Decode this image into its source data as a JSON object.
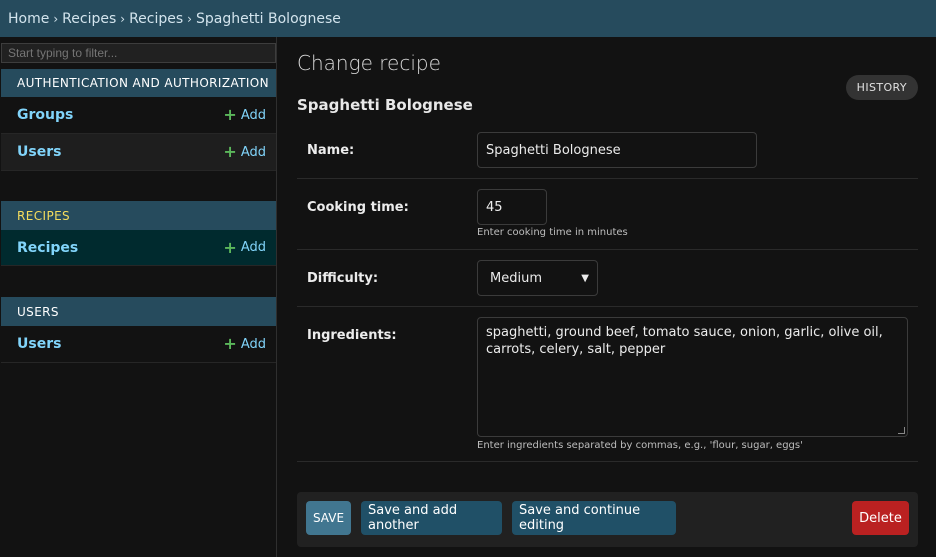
{
  "breadcrumbs": {
    "home": "Home",
    "app": "Recipes",
    "model": "Recipes",
    "current": "Spaghetti Bolognese",
    "separator": "›"
  },
  "sidebar": {
    "filter_placeholder": "Start typing to filter...",
    "add_label": "Add",
    "add_icon": "plus-icon",
    "modules": [
      {
        "caption": "AUTHENTICATION AND AUTHORIZATION",
        "items": [
          {
            "name": "Groups"
          },
          {
            "name": "Users"
          }
        ]
      },
      {
        "caption": "RECIPES",
        "items": [
          {
            "name": "Recipes"
          }
        ]
      },
      {
        "caption": "USERS",
        "items": [
          {
            "name": "Users"
          }
        ]
      }
    ]
  },
  "main": {
    "page_title": "Change recipe",
    "history_label": "HISTORY",
    "object_title": "Spaghetti Bolognese",
    "fields": {
      "name": {
        "label": "Name:",
        "value": "Spaghetti Bolognese"
      },
      "cooking_time": {
        "label": "Cooking time:",
        "value": "45",
        "help": "Enter cooking time in minutes"
      },
      "difficulty": {
        "label": "Difficulty:",
        "value": "Medium",
        "arrow_icon": "chevron-down-icon"
      },
      "ingredients": {
        "label": "Ingredients:",
        "value": "spaghetti, ground beef, tomato sauce, onion, garlic, olive oil, carrots, celery, salt, pepper",
        "help": "Enter ingredients separated by commas, e.g., 'flour, sugar, eggs'"
      }
    },
    "buttons": {
      "save": "SAVE",
      "save_add_another": "Save and add another",
      "save_continue": "Save and continue editing",
      "delete": "Delete"
    }
  },
  "colors": {
    "header_bg": "#264b5d",
    "link": "#81d4fa",
    "accent_yellow": "#f5dd5d",
    "save_button": "#417690",
    "secondary_button": "#205067",
    "delete_button": "#ba2121",
    "add_plus": "#5bb75b"
  }
}
